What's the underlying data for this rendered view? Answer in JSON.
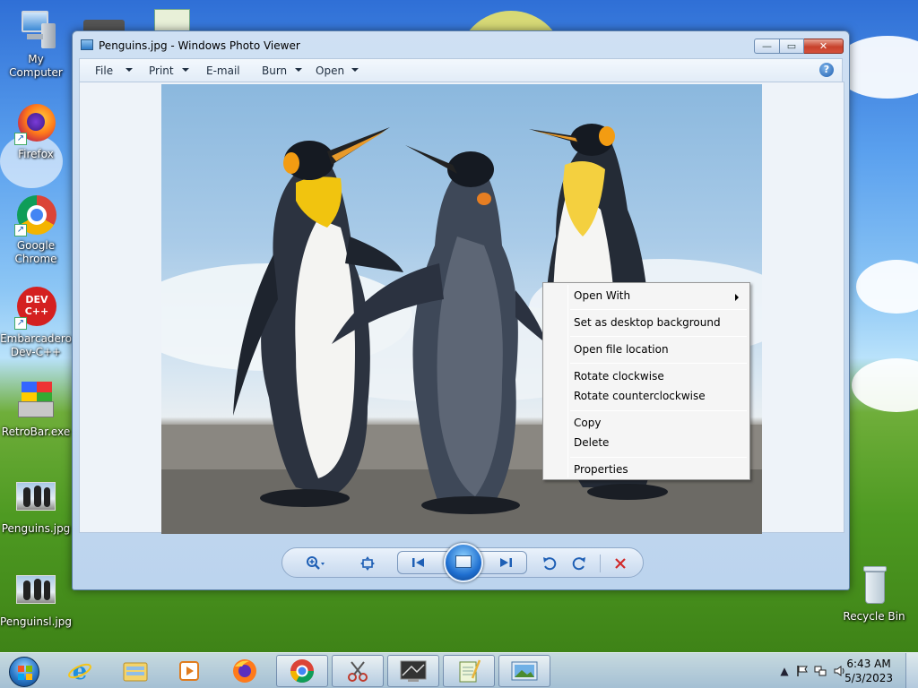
{
  "desktop": {
    "icons": [
      {
        "label": "My Computer",
        "icon": "computer-icon"
      },
      {
        "label": "Firefox",
        "icon": "firefox-icon"
      },
      {
        "label": "Google Chrome",
        "icon": "chrome-icon"
      },
      {
        "label": "Embarcadero Dev-C++",
        "icon": "devcpp-icon"
      },
      {
        "label": "RetroBar.exe",
        "icon": "retrobar-icon"
      },
      {
        "label": "Penguins.jpg",
        "icon": "image-file-icon"
      },
      {
        "label": "Penguinsl.jpg",
        "icon": "image-file-icon"
      },
      {
        "label": "Recycle Bin",
        "icon": "recycle-bin-icon"
      }
    ],
    "devcpp_badge": "DEV C++"
  },
  "window": {
    "title": "Penguins.jpg - Windows Photo Viewer",
    "caption": {
      "minimize": "—",
      "maximize": "▭",
      "close": "✕"
    },
    "menu": {
      "file": "File",
      "print": "Print",
      "email": "E-mail",
      "burn": "Burn",
      "open": "Open",
      "help": "?"
    }
  },
  "context_menu": {
    "items": [
      {
        "label": "Open With",
        "submenu": true
      },
      {
        "label": "Set as desktop background"
      },
      {
        "label": "Open file location"
      },
      {
        "label": "Rotate clockwise"
      },
      {
        "label": "Rotate counterclockwise"
      },
      {
        "label": "Copy"
      },
      {
        "label": "Delete"
      },
      {
        "label": "Properties"
      }
    ]
  },
  "controls": {
    "zoom": "zoom-icon",
    "actual_size": "fit-window-icon",
    "previous": "previous-icon",
    "slideshow": "slideshow-icon",
    "next": "next-icon",
    "rotate_ccw": "rotate-counterclockwise-icon",
    "rotate_cw": "rotate-clockwise-icon",
    "delete": "delete-icon"
  },
  "taskbar": {
    "buttons": [
      "internet-explorer-icon",
      "file-explorer-icon",
      "media-player-icon",
      "firefox-icon",
      "chrome-icon",
      "snipping-tool-icon",
      "paint-icon",
      "notepad-icon",
      "photo-viewer-icon"
    ],
    "clock": {
      "time": "6:43 AM",
      "date": "5/3/2023"
    }
  },
  "colors": {
    "accent": "#1e5fb5",
    "close_red": "#c7422c",
    "delete_red": "#d12a2a"
  }
}
